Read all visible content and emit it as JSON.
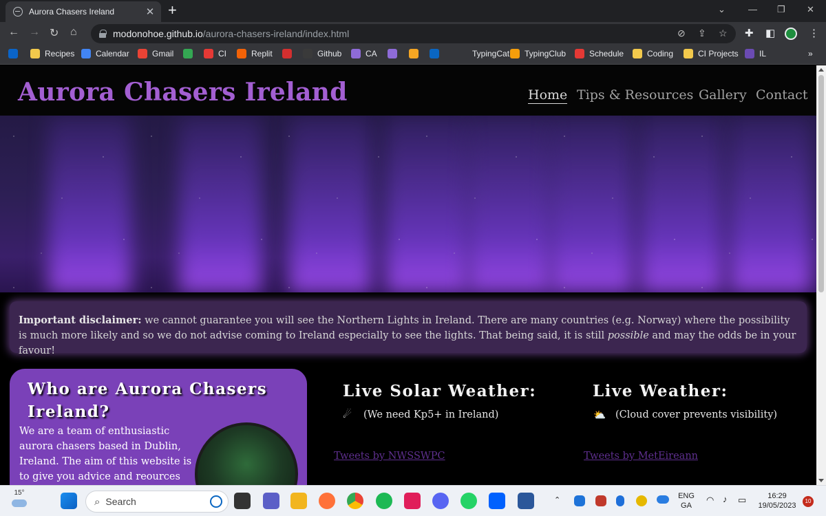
{
  "browser": {
    "tab_title": "Aurora Chasers Ireland",
    "new_tab": "+",
    "tab_close": "✕",
    "url_host": "modonohoe.github.io",
    "url_path": "/aurora-chasers-ireland/index.html",
    "bookmarks": [
      {
        "label": "Recipes",
        "color": "#f2c94c"
      },
      {
        "label": "Calendar",
        "color": "#4285f4"
      },
      {
        "label": "Gmail",
        "color": "#ea4335"
      },
      {
        "label": "",
        "color": "#34a853"
      },
      {
        "label": "CI",
        "color": "#e53935"
      },
      {
        "label": "Replit",
        "color": "#f26207"
      },
      {
        "label": "",
        "color": "#d32f2f"
      },
      {
        "label": "Github",
        "color": "#3a3a3a"
      },
      {
        "label": "CA",
        "color": "#8e6bd8"
      },
      {
        "label": "",
        "color": "#8e6bd8"
      },
      {
        "label": "",
        "color": "#f5a623"
      },
      {
        "label": "",
        "color": "#0a66c2"
      },
      {
        "label": "TypingCat",
        "color": "#35363a"
      },
      {
        "label": "TypingClub",
        "color": "#f59e0b"
      },
      {
        "label": "Schedule",
        "color": "#e53935"
      },
      {
        "label": "Coding",
        "color": "#f2c94c"
      },
      {
        "label": "CI Projects",
        "color": "#f2c94c"
      },
      {
        "label": "IL",
        "color": "#6b4bb3"
      }
    ],
    "more_bookmarks": "»"
  },
  "site": {
    "logo": "Aurora Chasers Ireland",
    "nav": [
      "Home",
      "Tips & Resources",
      "Gallery",
      "Contact"
    ],
    "disclaimer": {
      "bold": "Important disclaimer:",
      "text1": " we cannot guarantee you will see the Northern Lights in Ireland. There are many countries (e.g. Norway) where the possibility is much more likely and so we do not advise coming to Ireland especially to see the lights. That being said, it is still ",
      "italic": "possible",
      "text2": " and may the odds be in your favour!"
    },
    "who": {
      "heading": "Who are Aurora Chasers Ireland?",
      "body": "We are a team of enthusiastic aurora chasers based in Dublin, Ireland. The aim of this website is to give you advice and reources for"
    },
    "solar": {
      "heading": "Live Solar Weather:",
      "note": "(We need Kp5+ in Ireland)",
      "link": "Tweets by NWSSWPC"
    },
    "weather": {
      "heading": "Live Weather:",
      "note": "(Cloud cover prevents visibility)",
      "link": "Tweets by MetEireann"
    }
  },
  "taskbar": {
    "temp": "15°",
    "search_label": "Search",
    "lang1": "ENG",
    "lang2": "GA",
    "time": "16:29",
    "date": "19/05/2023",
    "notif": "10"
  }
}
